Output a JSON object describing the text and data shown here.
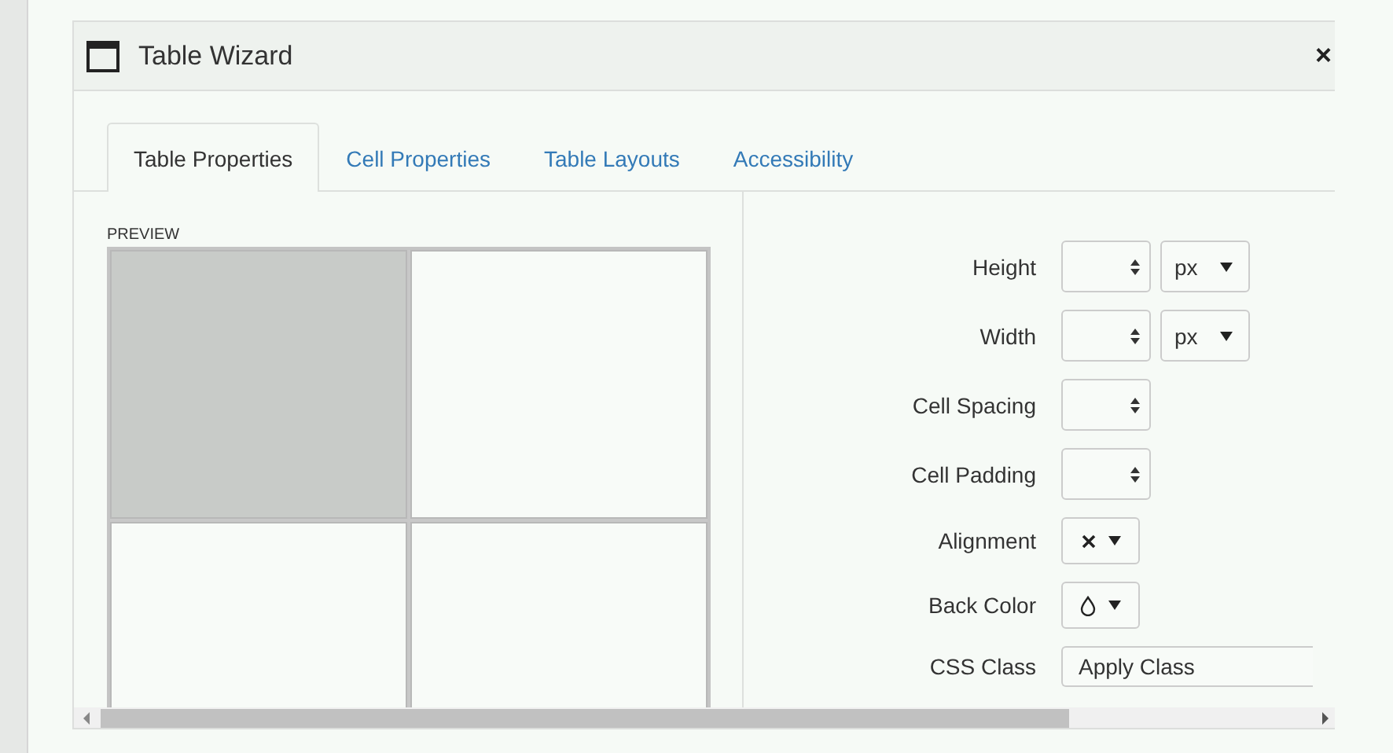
{
  "dialog": {
    "title": "Table Wizard",
    "close": "×"
  },
  "tabs": [
    {
      "label": "Table Properties",
      "selected": true
    },
    {
      "label": "Cell Properties",
      "selected": false
    },
    {
      "label": "Table Layouts",
      "selected": false
    },
    {
      "label": "Accessibility",
      "selected": false
    }
  ],
  "preview": {
    "label": "PREVIEW",
    "cells": [
      {
        "selected": true
      },
      {
        "selected": false
      },
      {
        "selected": false
      },
      {
        "selected": false
      }
    ]
  },
  "fields": [
    {
      "label": "Height",
      "kind": "spinner",
      "unit": "px"
    },
    {
      "label": "Width",
      "kind": "spinner",
      "unit": "px"
    },
    {
      "label": "Cell Spacing",
      "kind": "spinner"
    },
    {
      "label": "Cell Padding",
      "kind": "spinner"
    },
    {
      "label": "Alignment",
      "kind": "align-picker"
    },
    {
      "label": "Back Color",
      "kind": "color-picker"
    },
    {
      "label": "CSS Class",
      "kind": "class-field",
      "value": "Apply Class"
    }
  ]
}
